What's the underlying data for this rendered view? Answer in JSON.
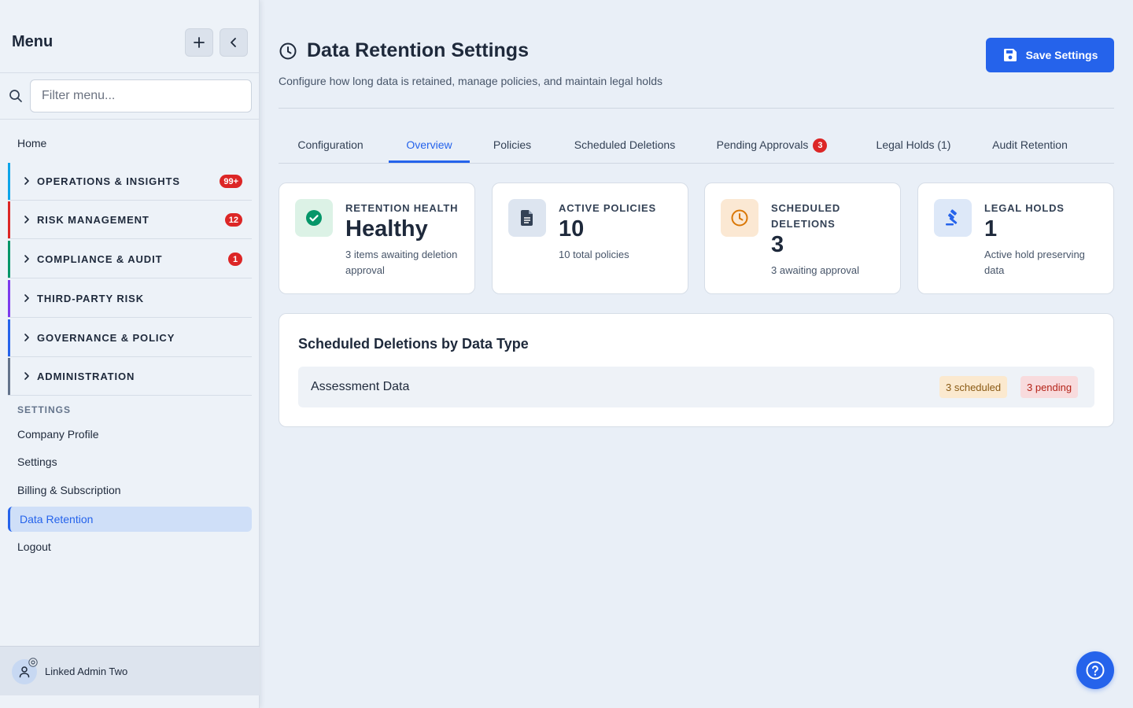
{
  "sidebar": {
    "title": "Menu",
    "add_icon": "plus-icon",
    "collapse_icon": "chevron-left-icon",
    "search_placeholder": "Filter menu...",
    "home_label": "Home",
    "groups": [
      {
        "label": "OPERATIONS & INSIGHTS",
        "badge": "99+",
        "accent": "#0ea5e9"
      },
      {
        "label": "RISK MANAGEMENT",
        "badge": "12",
        "accent": "#dc2626"
      },
      {
        "label": "COMPLIANCE & AUDIT",
        "badge": "1",
        "accent": "#059669"
      },
      {
        "label": "THIRD-PARTY RISK",
        "badge": "",
        "accent": "#7c3aed"
      },
      {
        "label": "GOVERNANCE & POLICY",
        "badge": "",
        "accent": "#2563eb"
      },
      {
        "label": "ADMINISTRATION",
        "badge": "",
        "accent": "#64748b"
      }
    ],
    "settings_section": "SETTINGS",
    "settings_items": [
      "Company Profile",
      "Settings",
      "Billing & Subscription",
      "Data Retention",
      "Logout"
    ],
    "active_item": "Data Retention",
    "user_name": "Linked Admin Two"
  },
  "header": {
    "title": "Data Retention Settings",
    "subtitle": "Configure how long data is retained, manage policies, and maintain legal holds",
    "save_label": "Save Settings"
  },
  "tabs": [
    {
      "label": "Configuration"
    },
    {
      "label": "Overview",
      "active": true
    },
    {
      "label": "Policies"
    },
    {
      "label": "Scheduled Deletions"
    },
    {
      "label": "Pending Approvals",
      "badge": "3"
    },
    {
      "label": "Legal Holds (1)"
    },
    {
      "label": "Audit Retention"
    }
  ],
  "cards": [
    {
      "label": "RETENTION HEALTH",
      "value": "Healthy",
      "note": "3 items awaiting deletion approval",
      "icon": "check-circle-icon",
      "icon_bg": "#dcf2e6",
      "icon_color": "#059669"
    },
    {
      "label": "ACTIVE POLICIES",
      "value": "10",
      "note": "10 total policies",
      "icon": "document-icon",
      "icon_bg": "#dde5f0",
      "icon_color": "#334155"
    },
    {
      "label": "SCHEDULED DELETIONS",
      "value": "3",
      "note": "3 awaiting approval",
      "icon": "clock-icon",
      "icon_bg": "#fbe8d3",
      "icon_color": "#d97706"
    },
    {
      "label": "LEGAL HOLDS",
      "value": "1",
      "note": "Active hold preserving data",
      "icon": "gavel-icon",
      "icon_bg": "#dde8f8",
      "icon_color": "#2563eb"
    }
  ],
  "panel": {
    "title": "Scheduled Deletions by Data Type",
    "rows": [
      {
        "label": "Assessment Data",
        "scheduled": "3 scheduled",
        "pending": "3 pending"
      }
    ]
  },
  "help_icon": "question-circle-icon"
}
